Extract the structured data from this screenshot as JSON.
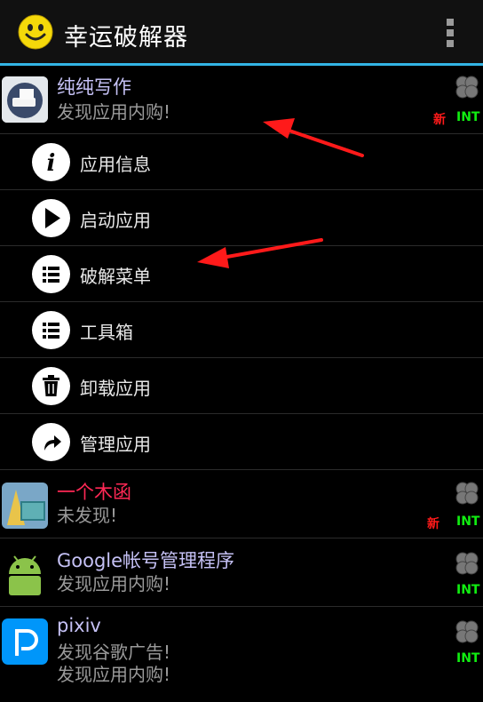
{
  "header": {
    "title": "幸运破解器",
    "logo_icon": "smiley-icon",
    "overflow_icon": "overflow-menu-icon"
  },
  "apps": [
    {
      "name": "纯纯写作",
      "status": [
        "发现应用内购!"
      ],
      "badge_new": "新",
      "badge_int": "INT",
      "icon": "typewriter-icon"
    },
    {
      "name": "一个木函",
      "status": [
        "未发现!"
      ],
      "badge_new": "新",
      "badge_int": "INT",
      "icon": "wooden-box-icon"
    },
    {
      "name": "Google帐号管理程序",
      "status": [
        "发现应用内购!"
      ],
      "badge_new": "",
      "badge_int": "INT",
      "icon": "android-icon"
    },
    {
      "name": "pixiv",
      "status": [
        "发现谷歌广告!",
        "发现应用内购!"
      ],
      "badge_new": "",
      "badge_int": "INT",
      "icon": "pixiv-icon"
    }
  ],
  "context_menu": [
    {
      "label": "应用信息",
      "icon": "info-icon"
    },
    {
      "label": "启动应用",
      "icon": "play-icon"
    },
    {
      "label": "破解菜单",
      "icon": "list-icon"
    },
    {
      "label": "工具箱",
      "icon": "list-icon"
    },
    {
      "label": "卸载应用",
      "icon": "trash-icon"
    },
    {
      "label": "管理应用",
      "icon": "share-icon"
    }
  ],
  "colors": {
    "accent": "#33b5e5",
    "app_name": "#c5c1f5",
    "new_badge": "#ff1a1a",
    "int_badge": "#11ee11",
    "annotation_arrow": "#ff1a1a"
  }
}
